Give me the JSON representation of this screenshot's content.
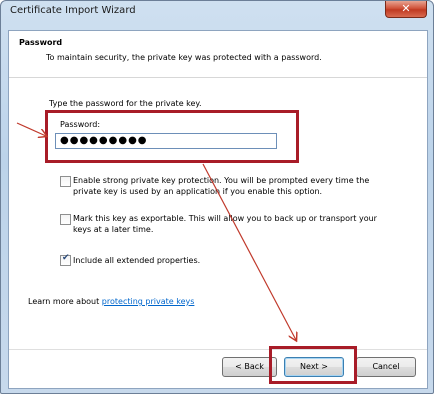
{
  "window": {
    "title": "Certificate Import Wizard",
    "close_glyph": "✕"
  },
  "header": {
    "title": "Password",
    "subtitle": "To maintain security, the private key was protected with a password."
  },
  "body": {
    "instruction": "Type the password for the private key.",
    "password_label": "Password:",
    "password_value": "●●●●●●●●●",
    "options": [
      {
        "line1": "Enable strong private key protection. You will be prompted every time the",
        "line2": "private key is used by an application if you enable this option.",
        "checked": false
      },
      {
        "line1": "Mark this key as exportable. This will allow you to back up or transport your",
        "line2": "keys at a later time.",
        "checked": false
      },
      {
        "line1": "Include all extended properties.",
        "line2": "",
        "checked": true
      }
    ],
    "learn_prefix": "Learn more about ",
    "learn_link": "protecting private keys"
  },
  "buttons": {
    "back": "< Back",
    "next": "Next >",
    "cancel": "Cancel"
  },
  "annotation": {
    "color": "#a81c28"
  }
}
